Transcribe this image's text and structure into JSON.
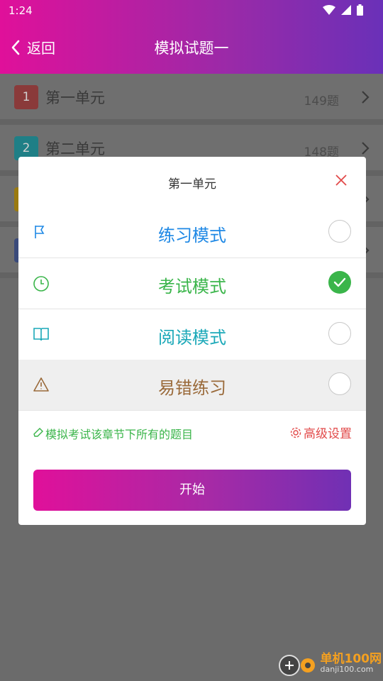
{
  "statusbar": {
    "time": "1:24"
  },
  "toolbar": {
    "back_label": "返回",
    "title": "模拟试题一"
  },
  "units": [
    {
      "index": "1",
      "name": "第一单元",
      "count": "149题",
      "color": "#8a3a3a"
    },
    {
      "index": "2",
      "name": "第二单元",
      "count": "148题",
      "color": "#1f7f86"
    }
  ],
  "dialog": {
    "title": "第一单元",
    "modes": [
      {
        "label": "练习模式",
        "icon": "flag-icon",
        "color": "#1e88e5",
        "checked": false
      },
      {
        "label": "考试模式",
        "icon": "clock-icon",
        "color": "#3ab54a",
        "checked": true
      },
      {
        "label": "阅读模式",
        "icon": "book-icon",
        "color": "#1aa8b8",
        "checked": false
      },
      {
        "label": "易错练习",
        "icon": "warning-icon",
        "color": "#9a6a3a",
        "checked": false
      }
    ],
    "hint": "模拟考试该章节下所有的题目",
    "advanced_label": "高级设置",
    "start_label": "开始"
  },
  "watermark": {
    "line1": "单机100网",
    "line2": "danji100.com"
  }
}
